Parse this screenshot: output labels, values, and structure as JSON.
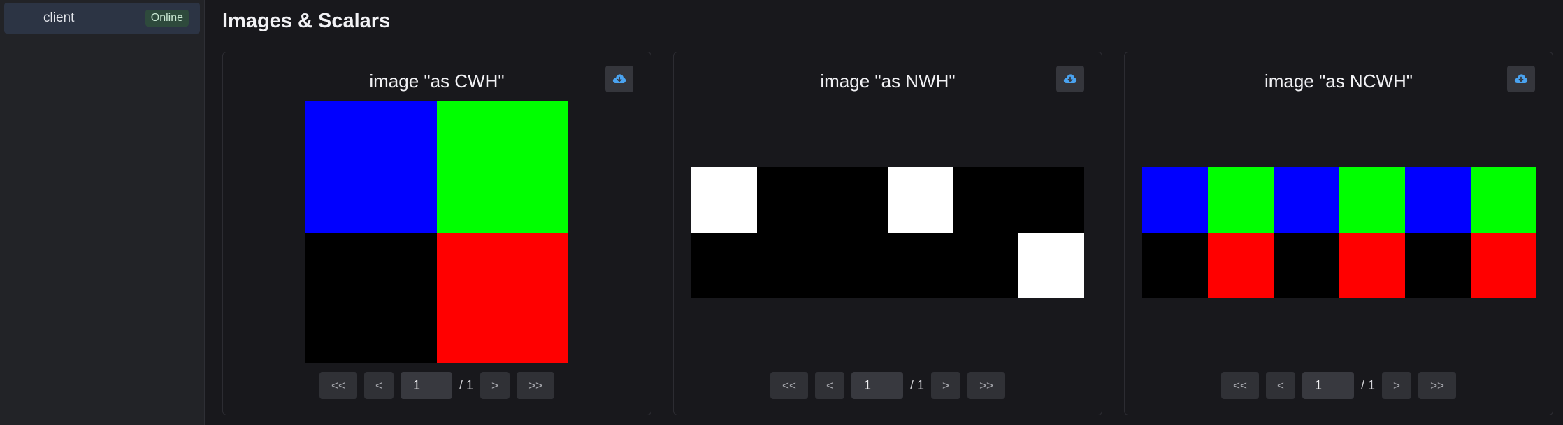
{
  "sidebar": {
    "client": {
      "label": "client",
      "status": "Online"
    }
  },
  "header": {
    "title": "Images & Scalars"
  },
  "panels": [
    {
      "title": "image \"as CWH\"",
      "download_icon": "cloud-download-icon",
      "image": {
        "rows": 2,
        "cols": 2,
        "colors": [
          "#0000ff",
          "#00ff00",
          "#000000",
          "#ff0000"
        ]
      },
      "pager": {
        "first": "<<",
        "prev": "<",
        "page": "1",
        "total": "/ 1",
        "next": ">",
        "last": ">>"
      }
    },
    {
      "title": "image \"as NWH\"",
      "download_icon": "cloud-download-icon",
      "image": {
        "rows": 2,
        "cols": 6,
        "colors": [
          "#ffffff",
          "#000000",
          "#000000",
          "#ffffff",
          "#000000",
          "#000000",
          "#000000",
          "#000000",
          "#000000",
          "#000000",
          "#000000",
          "#ffffff"
        ]
      },
      "pager": {
        "first": "<<",
        "prev": "<",
        "page": "1",
        "total": "/ 1",
        "next": ">",
        "last": ">>"
      }
    },
    {
      "title": "image \"as NCWH\"",
      "download_icon": "cloud-download-icon",
      "image": {
        "rows": 2,
        "cols": 6,
        "colors": [
          "#0000ff",
          "#00ff00",
          "#0000ff",
          "#00ff00",
          "#0000ff",
          "#00ff00",
          "#000000",
          "#ff0000",
          "#000000",
          "#ff0000",
          "#000000",
          "#ff0000"
        ]
      },
      "pager": {
        "first": "<<",
        "prev": "<",
        "page": "1",
        "total": "/ 1",
        "next": ">",
        "last": ">>"
      }
    }
  ]
}
